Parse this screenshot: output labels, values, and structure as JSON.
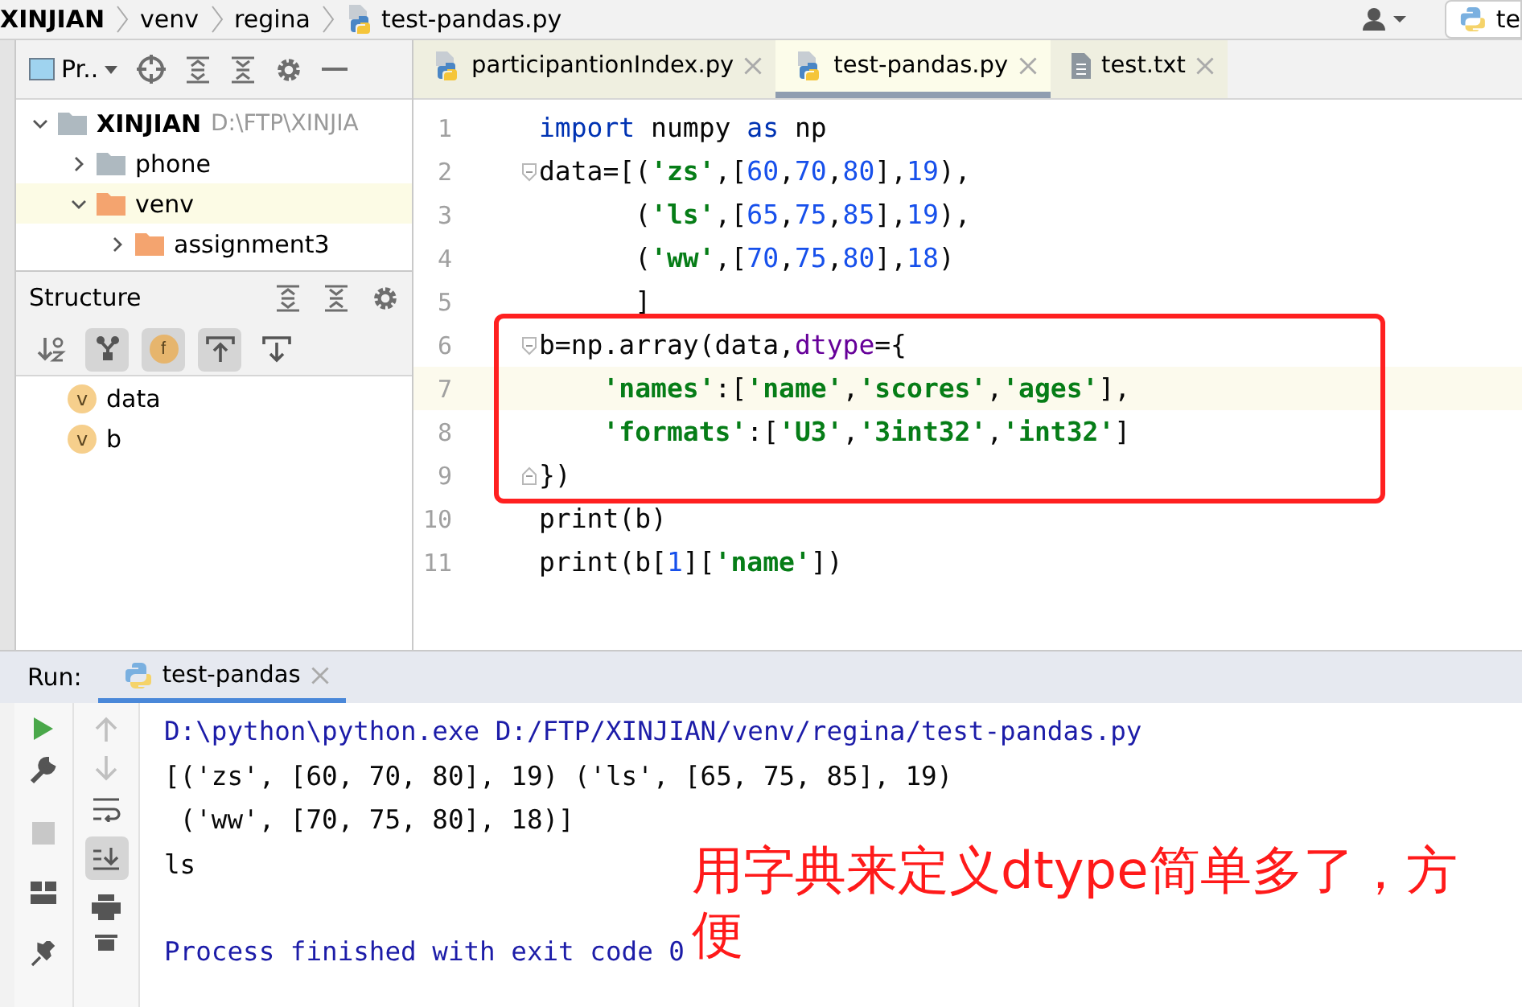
{
  "breadcrumb": [
    "XINJIAN",
    "venv",
    "regina",
    "test-pandas.py"
  ],
  "run_config": {
    "label": "te"
  },
  "project_panel": {
    "title": "Pr..",
    "tree": [
      {
        "name": "XINJIAN",
        "path": "D:\\FTP\\XINJIA",
        "expanded": true,
        "children": [
          {
            "name": "phone",
            "expanded": false,
            "selected": false,
            "color": "#aeb9c0"
          },
          {
            "name": "venv",
            "expanded": true,
            "selected": true,
            "color": "#f4a46f",
            "children": [
              {
                "name": "assignment3",
                "expanded": false,
                "selected": false,
                "color": "#f4a46f"
              }
            ]
          }
        ]
      }
    ]
  },
  "structure_panel": {
    "title": "Structure",
    "filter_badge": "f",
    "items": [
      {
        "badge": "v",
        "name": "data"
      },
      {
        "badge": "v",
        "name": "b"
      }
    ]
  },
  "tabs": [
    {
      "label": "participantionIndex.py",
      "kind": "python",
      "selected": false
    },
    {
      "label": "test-pandas.py",
      "kind": "python",
      "selected": true
    },
    {
      "label": "test.txt",
      "kind": "text",
      "selected": false
    }
  ],
  "code": [
    {
      "number": "1",
      "current": false,
      "fold": false,
      "tokens": [
        {
          "kind": "kw",
          "text": "import"
        },
        {
          "kind": "plain",
          "text": " numpy "
        },
        {
          "kind": "kw",
          "text": "as"
        },
        {
          "kind": "plain",
          "text": " np"
        }
      ]
    },
    {
      "number": "2",
      "current": false,
      "fold": true,
      "tokens": [
        {
          "kind": "plain",
          "text": "data=[("
        },
        {
          "kind": "str",
          "text": "'zs'"
        },
        {
          "kind": "plain",
          "text": ",["
        },
        {
          "kind": "num",
          "text": "60"
        },
        {
          "kind": "plain",
          "text": ","
        },
        {
          "kind": "num",
          "text": "70"
        },
        {
          "kind": "plain",
          "text": ","
        },
        {
          "kind": "num",
          "text": "80"
        },
        {
          "kind": "plain",
          "text": "],"
        },
        {
          "kind": "num",
          "text": "19"
        },
        {
          "kind": "plain",
          "text": "),"
        }
      ]
    },
    {
      "number": "3",
      "current": false,
      "fold": false,
      "tokens": [
        {
          "kind": "plain",
          "text": "      ("
        },
        {
          "kind": "str",
          "text": "'ls'"
        },
        {
          "kind": "plain",
          "text": ",["
        },
        {
          "kind": "num",
          "text": "65"
        },
        {
          "kind": "plain",
          "text": ","
        },
        {
          "kind": "num",
          "text": "75"
        },
        {
          "kind": "plain",
          "text": ","
        },
        {
          "kind": "num",
          "text": "85"
        },
        {
          "kind": "plain",
          "text": "],"
        },
        {
          "kind": "num",
          "text": "19"
        },
        {
          "kind": "plain",
          "text": "),"
        }
      ]
    },
    {
      "number": "4",
      "current": false,
      "fold": false,
      "tokens": [
        {
          "kind": "plain",
          "text": "      ("
        },
        {
          "kind": "str",
          "text": "'ww'"
        },
        {
          "kind": "plain",
          "text": ",["
        },
        {
          "kind": "num",
          "text": "70"
        },
        {
          "kind": "plain",
          "text": ","
        },
        {
          "kind": "num",
          "text": "75"
        },
        {
          "kind": "plain",
          "text": ","
        },
        {
          "kind": "num",
          "text": "80"
        },
        {
          "kind": "plain",
          "text": "],"
        },
        {
          "kind": "num",
          "text": "18"
        },
        {
          "kind": "plain",
          "text": ")"
        }
      ]
    },
    {
      "number": "5",
      "current": false,
      "fold": false,
      "tokens": [
        {
          "kind": "plain",
          "text": "      ]"
        }
      ]
    },
    {
      "number": "6",
      "current": false,
      "fold": true,
      "tokens": [
        {
          "kind": "plain",
          "text": "b=np.array(data,"
        },
        {
          "kind": "param",
          "text": "dtype"
        },
        {
          "kind": "plain",
          "text": "={"
        }
      ]
    },
    {
      "number": "7",
      "current": true,
      "fold": false,
      "tokens": [
        {
          "kind": "str",
          "text": "    'names'"
        },
        {
          "kind": "plain",
          "text": ":["
        },
        {
          "kind": "str",
          "text": "'name'"
        },
        {
          "kind": "plain",
          "text": ","
        },
        {
          "kind": "str",
          "text": "'scores'"
        },
        {
          "kind": "plain",
          "text": ","
        },
        {
          "kind": "str",
          "text": "'ages'"
        },
        {
          "kind": "plain",
          "text": "],"
        }
      ]
    },
    {
      "number": "8",
      "current": false,
      "fold": false,
      "tokens": [
        {
          "kind": "str",
          "text": "    'formats'"
        },
        {
          "kind": "plain",
          "text": ":["
        },
        {
          "kind": "str",
          "text": "'U3'"
        },
        {
          "kind": "plain",
          "text": ","
        },
        {
          "kind": "str",
          "text": "'3int32'"
        },
        {
          "kind": "plain",
          "text": ","
        },
        {
          "kind": "str",
          "text": "'int32'"
        },
        {
          "kind": "plain",
          "text": "]"
        }
      ]
    },
    {
      "number": "9",
      "current": false,
      "fold": true,
      "tokens": [
        {
          "kind": "plain",
          "text": "})"
        }
      ]
    },
    {
      "number": "10",
      "current": false,
      "fold": false,
      "tokens": [
        {
          "kind": "plain",
          "text": "print(b)"
        }
      ]
    },
    {
      "number": "11",
      "current": false,
      "fold": false,
      "tokens": [
        {
          "kind": "plain",
          "text": "print(b["
        },
        {
          "kind": "num",
          "text": "1"
        },
        {
          "kind": "plain",
          "text": "]["
        },
        {
          "kind": "str",
          "text": "'name'"
        },
        {
          "kind": "plain",
          "text": "])"
        }
      ]
    }
  ],
  "run_panel": {
    "label": "Run:",
    "tab": "test-pandas",
    "output": [
      {
        "kind": "system",
        "text": "D:\\python\\python.exe D:/FTP/XINJIAN/venv/regina/test-pandas.py"
      },
      {
        "kind": "stdout",
        "text": "[('zs', [60, 70, 80], 19) ('ls', [65, 75, 85], 19)"
      },
      {
        "kind": "stdout",
        "text": " ('ww', [70, 75, 80], 18)]"
      },
      {
        "kind": "stdout",
        "text": "ls"
      },
      {
        "kind": "exit",
        "text": "Process finished with exit code 0"
      }
    ]
  },
  "annotation": {
    "text": "用字典来定义dtype简单多了，方便"
  }
}
